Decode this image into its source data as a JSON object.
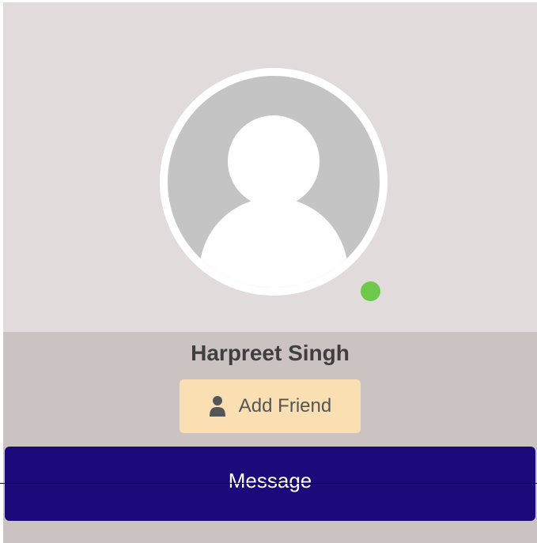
{
  "profile": {
    "name": "Harpreet Singh",
    "online": true
  },
  "actions": {
    "add_friend_label": "Add Friend",
    "message_label": "Message"
  },
  "colors": {
    "card_background": "#e2dbdb",
    "info_background": "#cbc2c2",
    "avatar_placeholder": "#c4c4c4",
    "online_status": "#6dc84b",
    "add_friend_background": "#f9dfb1",
    "message_background": "#1d0a7a"
  },
  "icons": {
    "avatar": "user-placeholder-icon",
    "add_friend": "user-icon",
    "status": "online-status-dot"
  }
}
